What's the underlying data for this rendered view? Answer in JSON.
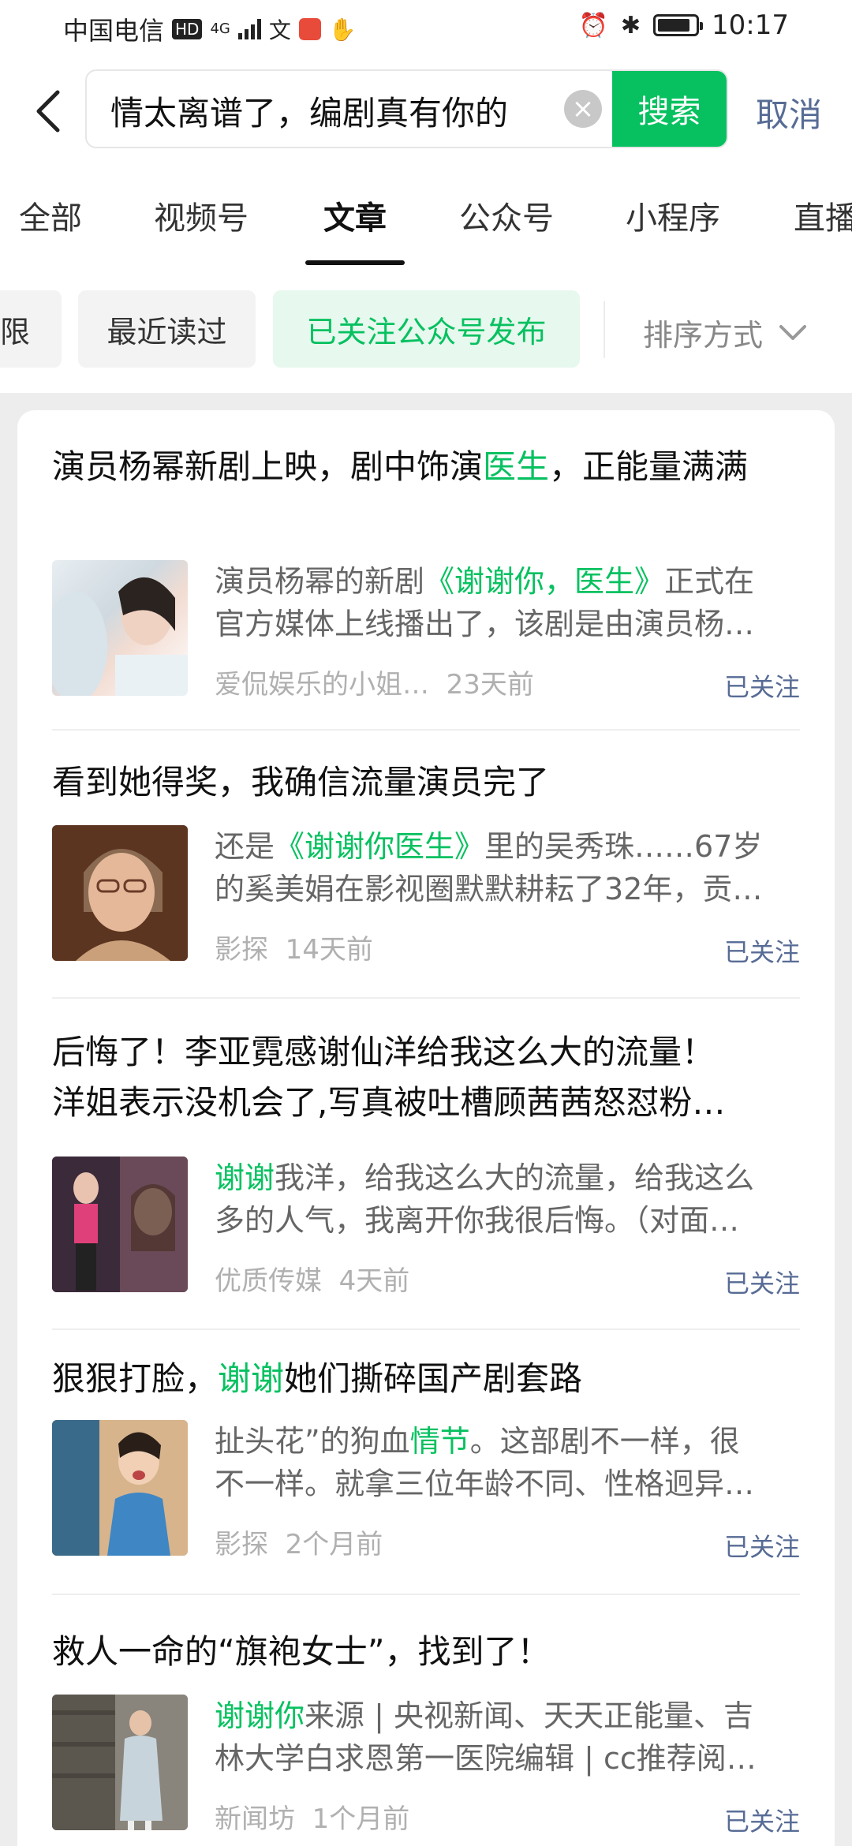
{
  "status": {
    "carrier": "中国电信",
    "hd": "HD",
    "network": "4G",
    "time": "10:17"
  },
  "search": {
    "query": "情太离谱了，编剧真有你的",
    "button": "搜索",
    "cancel": "取消"
  },
  "tabs": [
    "全部",
    "视频号",
    "文章",
    "公众号",
    "小程序",
    "直播"
  ],
  "active_tab": "文章",
  "filters": {
    "partial": "限",
    "recent": "最近读过",
    "followed": "已关注公众号发布",
    "sort": "排序方式"
  },
  "colors": {
    "accent": "#07c160",
    "link": "#576b95"
  },
  "results": [
    {
      "title_a": "演员杨幂新剧上映，剧中饰演",
      "title_hl": "医生",
      "title_b": "，正能量满满",
      "snip_a": "演员杨幂的新剧",
      "snip_hl": "《谢谢你，医生》",
      "snip_b": "正式在",
      "snip_line2": "官方媒体上线播出了，该剧是由演员杨…",
      "source": "爱侃娱乐的小姐…",
      "time": "23天前",
      "follow": "已关注"
    },
    {
      "title_a": "看到她得奖，我确信流量演员完了",
      "title_hl": "",
      "title_b": "",
      "snip_a": "还是",
      "snip_hl": "《谢谢你医生》",
      "snip_b": "里的吴秀珠……67岁",
      "snip_line2": "的奚美娟在影视圈默默耕耘了32年，贡…",
      "source": "影探",
      "time": "14天前",
      "follow": "已关注"
    },
    {
      "title_a": "后悔了！李亚霓感谢仙洋给我这么大的流量！",
      "title_line2": "洋姐表示没机会了,写真被吐槽顾茜茜怒怼粉…",
      "snip_a": "",
      "snip_hl": "谢谢",
      "snip_b": "我洋，给我这么大的流量，给我这么",
      "snip_line2": "多的人气，我离开你我很后悔。（对面…",
      "source": "优质传媒",
      "time": "4天前",
      "follow": "已关注"
    },
    {
      "title_a": "狠狠打脸，",
      "title_hl": "谢谢",
      "title_b": "她们撕碎国产剧套路",
      "snip_a": "扯头花”的狗血",
      "snip_hl": "情节",
      "snip_b": "。这部剧不一样，很",
      "snip_line2": "不一样。就拿三位年龄不同、性格迥异…",
      "source": "影探",
      "time": "2个月前",
      "follow": "已关注"
    },
    {
      "title_a": "救人一命的“旗袍女士”，找到了！",
      "title_hl": "",
      "title_b": "",
      "snip_a": "",
      "snip_hl": "谢谢你",
      "snip_b": "来源 | 央视新闻、天天正能量、吉",
      "snip_line2": "林大学白求恩第一医院编辑 | cc推荐阅…",
      "source": "新闻坊",
      "time": "1个月前",
      "follow": "已关注"
    }
  ]
}
